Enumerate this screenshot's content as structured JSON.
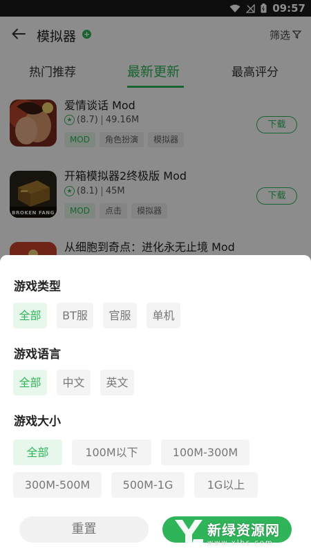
{
  "status_bar": {
    "time": "09:57"
  },
  "app_bar": {
    "title": "模拟器",
    "filter_label": "筛选"
  },
  "tabs": [
    {
      "label": "热门推荐"
    },
    {
      "label": "最新更新"
    },
    {
      "label": "最高评分"
    }
  ],
  "games": [
    {
      "title": "爱情谈话 Mod",
      "rating": "(8.7)",
      "size": "49.16M",
      "tags": [
        "MOD",
        "角色扮演",
        "模拟器"
      ],
      "download_label": "下载"
    },
    {
      "title": "开箱模拟器2终极版 Mod",
      "rating": "(8.1)",
      "size": "45M",
      "tags": [
        "MOD",
        "点击",
        "模拟器"
      ],
      "download_label": "下载",
      "icon_text": "BROKEN FANG"
    },
    {
      "title": "从细胞到奇点：进化永无止境 Mod"
    }
  ],
  "filter_sheet": {
    "game_type": {
      "title": "游戏类型",
      "options": [
        "全部",
        "BT服",
        "官服",
        "单机"
      ],
      "selected": "全部"
    },
    "game_language": {
      "title": "游戏语言",
      "options": [
        "全部",
        "中文",
        "英文"
      ],
      "selected": "全部"
    },
    "game_size": {
      "title": "游戏大小",
      "options": [
        "全部",
        "100M以下",
        "100M-300M",
        "300M-500M",
        "500M-1G",
        "1G以上"
      ],
      "selected": "全部"
    },
    "reset_label": "重置"
  },
  "watermark": {
    "name": "新绿资源网",
    "url": "www.xlhs.com"
  },
  "colors": {
    "accent": "#2fb45a",
    "status_bar": "#1a1a1a",
    "overlay": "rgba(0,0,0,0.45)"
  }
}
